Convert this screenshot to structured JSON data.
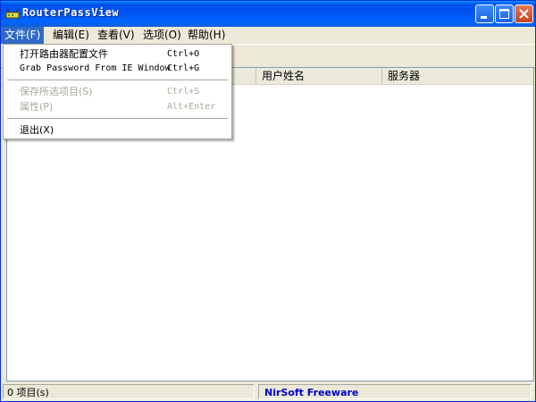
{
  "window": {
    "title": "RouterPassView"
  },
  "menubar": {
    "file": "文件(F)",
    "edit": "编辑(E)",
    "view": "查看(V)",
    "options": "选项(O)",
    "help": "帮助(H)"
  },
  "file_menu": {
    "items": [
      {
        "label": "打开路由器配置文件",
        "shortcut": "Ctrl+O",
        "enabled": true
      },
      {
        "label": "Grab Password From IE Window",
        "shortcut": "Ctrl+G",
        "enabled": true
      },
      {
        "label": "保存所选项目(S)",
        "shortcut": "Ctrl+S",
        "enabled": false
      },
      {
        "label": "属性(P)",
        "shortcut": "Alt+Enter",
        "enabled": false
      },
      {
        "label": "退出(X)",
        "shortcut": "",
        "enabled": true
      }
    ]
  },
  "list": {
    "columns": [
      "",
      "用户姓名",
      "服务器"
    ]
  },
  "statusbar": {
    "count": "0 项目(s)",
    "credit": "NirSoft Freeware"
  },
  "icons": {
    "app": "router-icon",
    "minimize": "minimize-icon",
    "maximize": "maximize-icon",
    "close": "close-icon"
  },
  "colors": {
    "titlebar": "#0054e3",
    "menu_highlight": "#316ac5",
    "disabled_text": "#aca899",
    "credit_link": "#0000cc"
  }
}
